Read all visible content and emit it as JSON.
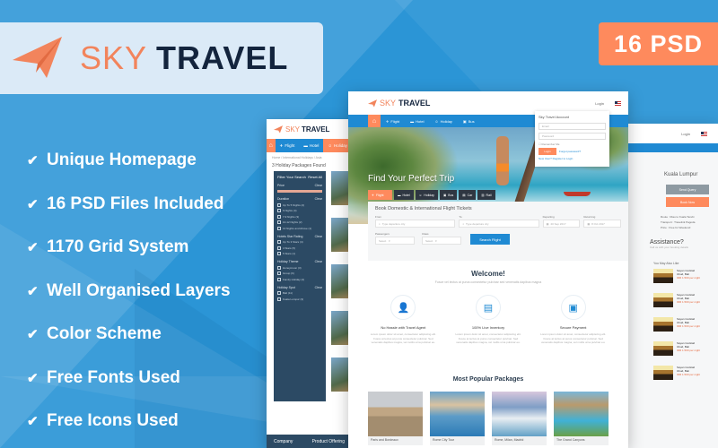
{
  "brand": {
    "name_part1": "SKY",
    "name_part2": "TRAVEL",
    "accent": "#f2845c",
    "dark": "#13243d",
    "blue": "#1f8ad3",
    "badge": "#fe8a5d"
  },
  "badge": {
    "label": "16 PSD"
  },
  "features": [
    {
      "label": "Unique Homepage"
    },
    {
      "label": "16 PSD Files Included"
    },
    {
      "label": "1170 Grid System"
    },
    {
      "label": "Well Organised Layers"
    },
    {
      "label": "Color Scheme"
    },
    {
      "label": "Free Fonts Used"
    },
    {
      "label": "Free Icons Used"
    }
  ],
  "left_mock": {
    "nav": [
      "Flight",
      "Hotel",
      "Holiday"
    ],
    "breadcrumb": "Home  /  International Holidays  /  Asia",
    "found": "3 Holiday Packages Found",
    "filter": {
      "title": "Filter Your Search",
      "reset": "Reset All",
      "sections": [
        {
          "name": "Price",
          "action": "Clear",
          "items": []
        },
        {
          "name": "Duration",
          "action": "Clear",
          "items": [
            "Up To 5 Nights (2)",
            "6 Nights (4)",
            "7-9 Nights (3)",
            "10-12 Nights (2)",
            "13 Nights and Above (1)"
          ]
        },
        {
          "name": "Hotels Star Rating",
          "action": "Clear",
          "items": [
            "Up To 3 Stars (4)",
            "4 Stars (5)",
            "5 Stars (1)"
          ]
        },
        {
          "name": "Holiday Theme",
          "action": "Clear",
          "items": [
            "Honeymoon (3)",
            "Group (6)",
            "Family Holiday (2)"
          ]
        },
        {
          "name": "Holiday Spot",
          "action": "Clear",
          "items": [
            "Bali (11)",
            "Kuala Lumpur (3)"
          ]
        }
      ]
    },
    "footer": [
      "Company",
      "Product Offering"
    ]
  },
  "center_mock": {
    "header_links": [
      "Login"
    ],
    "nav": [
      "Flight",
      "Hotel",
      "Holiday",
      "Bus"
    ],
    "login": {
      "title": "Sky Travel Account",
      "email_placeholder": "Email",
      "password_placeholder": "Password",
      "remember": "Remember Me",
      "login_button": "Login",
      "forgot": "Forgot password?",
      "signup": "New User? Register to Login"
    },
    "hero_title": "Find Your Perfect Trip",
    "hero_tabs": [
      "Flight",
      "Hotel",
      "Holiday",
      "Bus",
      "Car",
      "Rail"
    ],
    "booking": {
      "title": "Book Domestic & International Flight Tickets",
      "from_label": "From",
      "from_placeholder": "Type departure city",
      "to_label": "To",
      "to_placeholder": "Type departure city",
      "departing_label": "Departing",
      "departing_value": "20 Sep 2017",
      "returning_label": "Returning",
      "returning_value": "8 Oct 2017",
      "passengers_label": "Passengers",
      "passengers_value": "Select",
      "class_label": "Class",
      "class_value": "Select",
      "search_button": "Search Flight"
    },
    "welcome": {
      "title": "Welcome!",
      "subtitle": "Fusce vel lectus at purus consectetur pulvinar sed venenatis dapibus magna",
      "features": [
        {
          "icon": "user-icon",
          "title": "No Hassle with Travel Agent",
          "desc": "Lorem ipsum dolor sit amet, consectetur adipiscing elit. Fusce at lectus at purus consectetur pulvinar. Sed venenatis dapibus magna, vel mollis urna pulvinar eu."
        },
        {
          "icon": "calendar-icon",
          "title": "100% Live Inventory",
          "desc": "Lorem ipsum dolor sit amet, consectetur adipiscing elit. Fusce at lectus at purus consectetur pulvinar. Sed venenatis dapibus magna, vel mollis urna pulvinar eu."
        },
        {
          "icon": "money-icon",
          "title": "Secure Payment",
          "desc": "Lorem ipsum dolor sit amet, consectetur adipiscing elit. Fusce at lectus at purus consectetur pulvinar. Sed venenatis dapibus magna, vel mollis urna pulvinar eu."
        }
      ]
    },
    "packages": {
      "title": "Most Popular Packages",
      "items": [
        {
          "name": "Paris and Bordeaux"
        },
        {
          "name": "Rome City Tour"
        },
        {
          "name": "Rome, Milan, Madrid"
        },
        {
          "name": "The Grand Canyons"
        }
      ]
    }
  },
  "right_mock": {
    "header_link": "Login",
    "title": "Kuala Lumpur",
    "send_query": "Send Query",
    "book_now": "Book Now",
    "details": [
      "Route : Riau to Kuala Terebi",
      "Transport : Travelink Pagoda",
      "Price : Free for Weekend"
    ],
    "question": "Assistance?",
    "question_sub": "Call us with your booking details",
    "may_like_title": "You May Also Like",
    "hotels": [
      {
        "name": "Sayan Cocktail",
        "location": "Ubud, Bali",
        "price": "IDR 1.500 per night"
      },
      {
        "name": "Sayan Cocktail",
        "location": "Ubud, Bali",
        "price": "IDR 1.500 per night"
      },
      {
        "name": "Sayan Cocktail",
        "location": "Ubud, Bali",
        "price": "IDR 1.500 per night"
      },
      {
        "name": "Sayan Cocktail",
        "location": "Ubud, Bali",
        "price": "IDR 1.500 per night"
      },
      {
        "name": "Sayan Cocktail",
        "location": "Ubud, Bali",
        "price": "IDR 1.500 per night"
      }
    ]
  }
}
